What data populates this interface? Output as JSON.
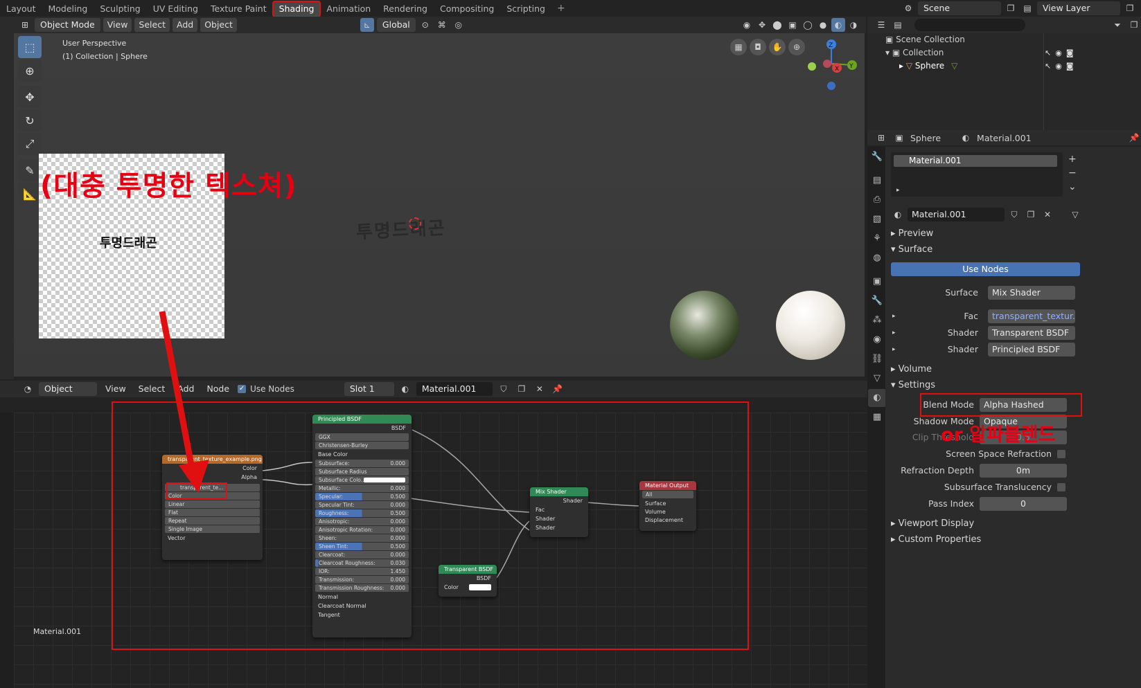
{
  "workspaces": [
    "Layout",
    "Modeling",
    "Sculpting",
    "UV Editing",
    "Texture Paint",
    "Shading",
    "Animation",
    "Rendering",
    "Compositing",
    "Scripting"
  ],
  "active_workspace": "Shading",
  "scene_name": "Scene",
  "view_layer": "View Layer",
  "viewport": {
    "mode": "Object Mode",
    "menus": [
      "View",
      "Select",
      "Add",
      "Object"
    ],
    "transform": "Global",
    "info_line1": "User Perspective",
    "info_line2": "(1) Collection | Sphere",
    "object_text": "투명드래곤"
  },
  "image_preview": {
    "text": "투명드래곤"
  },
  "annotations": {
    "transparent_texture": "(대충 투명한 텍스쳐)",
    "alpha_blend": "or 알파블렌드"
  },
  "outliner": {
    "scene_collection": "Scene Collection",
    "collection": "Collection",
    "object": "Sphere"
  },
  "properties": {
    "object": "Sphere",
    "material": "Material.001",
    "slot_material": "Material.001",
    "datablock": "Material.001",
    "sections": {
      "preview": "Preview",
      "surface": "Surface",
      "volume": "Volume",
      "settings": "Settings",
      "viewport_display": "Viewport Display",
      "custom_properties": "Custom Properties"
    },
    "use_nodes": "Use Nodes",
    "surface_label": "Surface",
    "surface_value": "Mix Shader",
    "fac_label": "Fac",
    "fac_value": "transparent_textur...",
    "shader1_label": "Shader",
    "shader1_value": "Transparent BSDF",
    "shader2_label": "Shader",
    "shader2_value": "Principled BSDF",
    "blend_mode_label": "Blend Mode",
    "blend_mode_value": "Alpha Hashed",
    "shadow_mode_label": "Shadow Mode",
    "shadow_mode_value": "Opaque",
    "clip_label": "Clip Threshold",
    "clip_value": "0.5",
    "ssr_label": "Screen Space Refraction",
    "refraction_depth_label": "Refraction Depth",
    "refraction_depth_value": "0m",
    "sss_label": "Subsurface Translucency",
    "pass_index_label": "Pass Index",
    "pass_index_value": "0"
  },
  "node_editor": {
    "type": "Object",
    "menus": [
      "View",
      "Select",
      "Add",
      "Node"
    ],
    "use_nodes": "Use Nodes",
    "slot": "Slot 1",
    "material": "Material.001",
    "footer": "Material.001",
    "image_node": {
      "title": "transparent_texture_example.png",
      "out_color": "Color",
      "out_alpha": "Alpha",
      "image_name": "transparent_te...",
      "options": [
        "Color",
        "Linear",
        "Flat",
        "Repeat",
        "Single Image"
      ],
      "in_vector": "Vector"
    },
    "principled": {
      "title": "Principled BSDF",
      "out": "BSDF",
      "dist": "GGX",
      "sss_method": "Christensen-Burley",
      "base_color": "Base Color",
      "fields": [
        {
          "label": "Subsurface:",
          "value": "0.000",
          "fill": 0
        },
        {
          "label": "Subsurface Radius",
          "value": "",
          "fill": 0
        },
        {
          "label": "Subsurface Colo...",
          "value": "",
          "fill": 0
        },
        {
          "label": "Metallic:",
          "value": "0.000",
          "fill": 0
        },
        {
          "label": "Specular:",
          "value": "0.500",
          "fill": 0.5
        },
        {
          "label": "Specular Tint:",
          "value": "0.000",
          "fill": 0
        },
        {
          "label": "Roughness:",
          "value": "0.500",
          "fill": 0.5
        },
        {
          "label": "Anisotropic:",
          "value": "0.000",
          "fill": 0
        },
        {
          "label": "Anisotropic Rotation:",
          "value": "0.000",
          "fill": 0
        },
        {
          "label": "Sheen:",
          "value": "0.000",
          "fill": 0
        },
        {
          "label": "Sheen Tint:",
          "value": "0.500",
          "fill": 0.5
        },
        {
          "label": "Clearcoat:",
          "value": "0.000",
          "fill": 0
        },
        {
          "label": "Clearcoat Roughness:",
          "value": "0.030",
          "fill": 0.03
        },
        {
          "label": "IOR:",
          "value": "1.450",
          "fill": 0
        },
        {
          "label": "Transmission:",
          "value": "0.000",
          "fill": 0
        },
        {
          "label": "Transmission Roughness:",
          "value": "0.000",
          "fill": 0
        }
      ],
      "inputs": [
        "Normal",
        "Clearcoat Normal",
        "Tangent"
      ]
    },
    "transparent": {
      "title": "Transparent BSDF",
      "out": "BSDF",
      "color": "Color"
    },
    "mix": {
      "title": "Mix Shader",
      "out": "Shader",
      "fac": "Fac",
      "sh1": "Shader",
      "sh2": "Shader"
    },
    "output": {
      "title": "Material Output",
      "target": "All",
      "surface": "Surface",
      "volume": "Volume",
      "displacement": "Displacement"
    }
  }
}
